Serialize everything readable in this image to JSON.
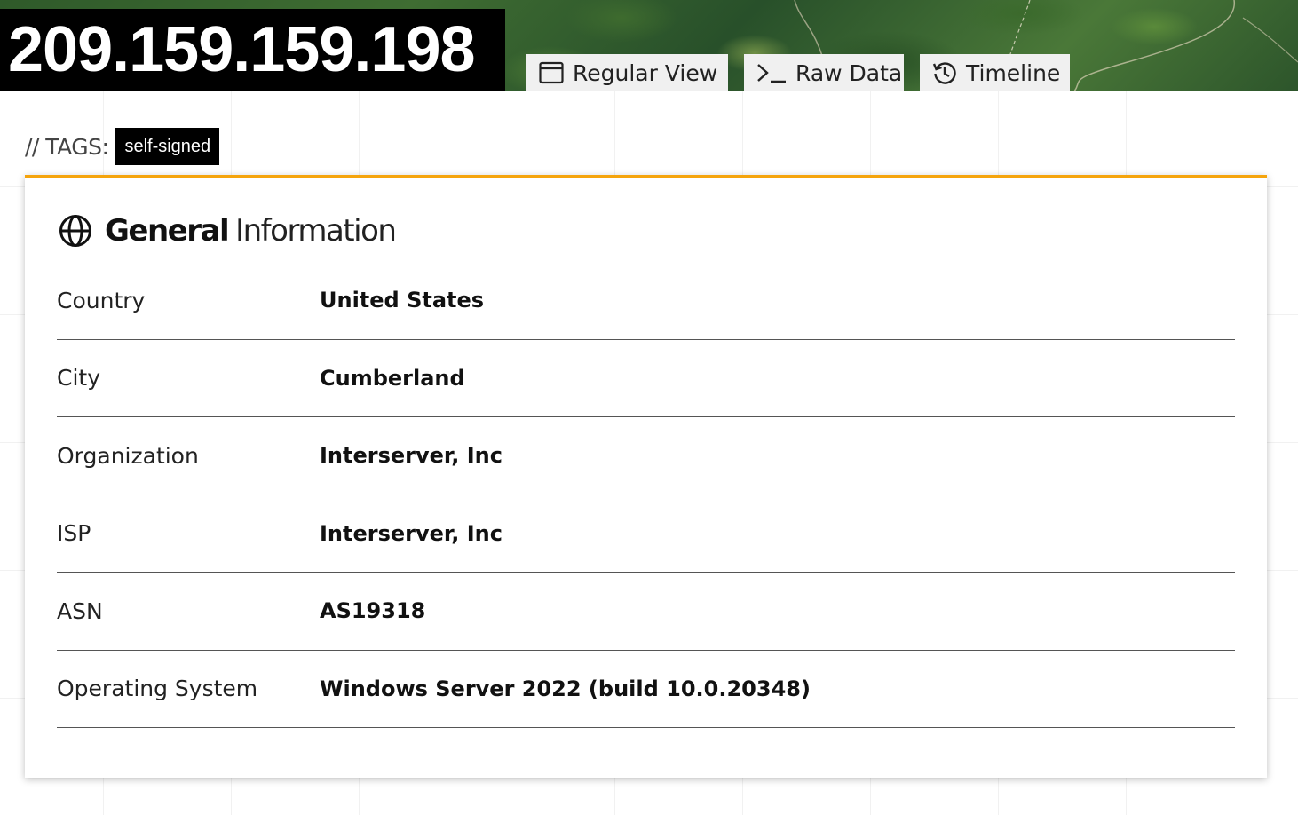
{
  "header": {
    "ip_address": "209.159.159.198",
    "tabs": [
      {
        "label": "Regular View",
        "icon": "browser-window-icon"
      },
      {
        "label": "Raw Data",
        "icon": "terminal-icon"
      },
      {
        "label": "Timeline",
        "icon": "history-icon"
      }
    ]
  },
  "tags": {
    "label": "// TAGS:",
    "items": [
      "self-signed"
    ]
  },
  "general_info": {
    "title_bold": "General",
    "title_light": "Information",
    "icon": "globe-icon",
    "accent_color": "#f5a40c",
    "rows": [
      {
        "key": "Country",
        "value": "United States"
      },
      {
        "key": "City",
        "value": "Cumberland"
      },
      {
        "key": "Organization",
        "value": "Interserver, Inc"
      },
      {
        "key": "ISP",
        "value": "Interserver, Inc"
      },
      {
        "key": "ASN",
        "value": "AS19318"
      },
      {
        "key": "Operating System",
        "value": "Windows Server 2022 (build 10.0.20348)"
      }
    ]
  }
}
